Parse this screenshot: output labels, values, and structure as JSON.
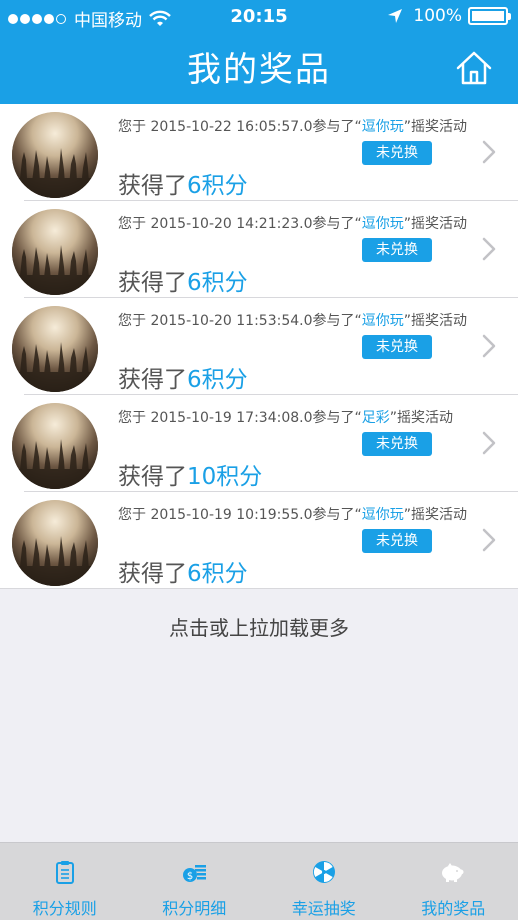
{
  "status_bar": {
    "carrier": "中国移动",
    "time": "20:15",
    "battery": "100%"
  },
  "header": {
    "title": "我的奖品",
    "home_icon": "home-icon"
  },
  "prizes": [
    {
      "prefix": "您于 2015-10-22 16:05:57.0参与了“",
      "activity": "逗你玩",
      "suffix": "”摇奖活动",
      "status": "未兑换",
      "gain_prefix": "获得了",
      "points": "6积分"
    },
    {
      "prefix": "您于 2015-10-20 14:21:23.0参与了“",
      "activity": "逗你玩",
      "suffix": "”摇奖活动",
      "status": "未兑换",
      "gain_prefix": "获得了",
      "points": "6积分"
    },
    {
      "prefix": "您于 2015-10-20 11:53:54.0参与了“",
      "activity": "逗你玩",
      "suffix": "”摇奖活动",
      "status": "未兑换",
      "gain_prefix": "获得了",
      "points": "6积分"
    },
    {
      "prefix": "您于 2015-10-19 17:34:08.0参与了“",
      "activity": "足彩",
      "suffix": "”摇奖活动",
      "status": "未兑换",
      "gain_prefix": "获得了",
      "points": "10积分"
    },
    {
      "prefix": "您于 2015-10-19 10:19:55.0参与了“",
      "activity": "逗你玩",
      "suffix": "”摇奖活动",
      "status": "未兑换",
      "gain_prefix": "获得了",
      "points": "6积分"
    }
  ],
  "load_more": "点击或上拉加载更多",
  "tabbar": [
    {
      "label": "积分规则",
      "icon": "clipboard-icon"
    },
    {
      "label": "积分明细",
      "icon": "money-icon"
    },
    {
      "label": "幸运抽奖",
      "icon": "wheel-icon"
    },
    {
      "label": "我的奖品",
      "icon": "piggy-bank-icon"
    }
  ],
  "colors": {
    "accent": "#1aa0e6",
    "background": "#efeff4",
    "tabbar": "#d7d7d9"
  }
}
